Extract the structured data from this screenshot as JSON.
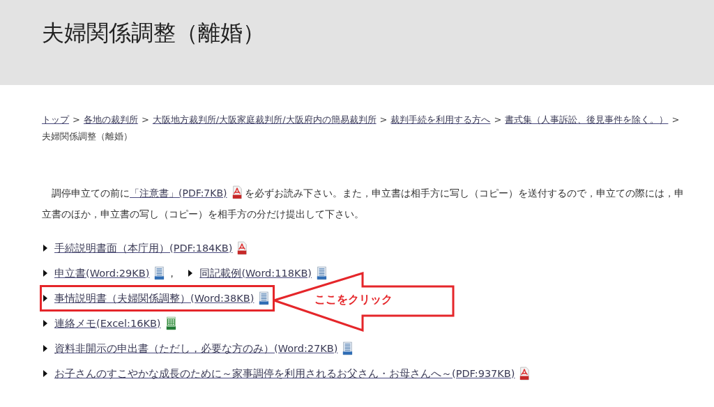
{
  "header": {
    "title": "夫婦関係調整（離婚）"
  },
  "breadcrumb": {
    "separator": ">",
    "items": [
      {
        "text": "トップ",
        "link": true
      },
      {
        "text": "各地の裁判所",
        "link": true
      },
      {
        "text": "大阪地方裁判所/大阪家庭裁判所/大阪府内の簡易裁判所",
        "link": true
      },
      {
        "text": "裁判手続を利用する方へ",
        "link": true
      },
      {
        "text": "書式集（人事訴訟、後見事件を除く。）",
        "link": true
      },
      {
        "text": "夫婦関係調整（離婚）",
        "link": false
      }
    ]
  },
  "notice": {
    "before": "調停申立ての前に",
    "link": "「注意書」(PDF:7KB)",
    "kind": "pdf",
    "after": "を必ずお読み下さい。また，申立書は相手方に写し（コピー）を送付するので，申立ての際には，申立書のほか，申立書の写し（コピー）を相手方の分だけ提出して下さい。"
  },
  "files": [
    {
      "highlighted": false,
      "links": [
        {
          "text": "手続説明書面（本庁用）(PDF:184KB)",
          "kind": "pdf"
        }
      ]
    },
    {
      "highlighted": false,
      "links": [
        {
          "text": "申立書(Word:29KB)",
          "kind": "doc",
          "separator": "，"
        },
        {
          "text": "同記載例(Word:118KB)",
          "kind": "doc"
        }
      ]
    },
    {
      "highlighted": true,
      "links": [
        {
          "text": "事情説明書（夫婦関係調整）(Word:38KB)",
          "kind": "doc"
        }
      ]
    },
    {
      "highlighted": false,
      "links": [
        {
          "text": "連絡メモ(Excel:16KB)",
          "kind": "xls"
        }
      ]
    },
    {
      "highlighted": false,
      "links": [
        {
          "text": "資料非開示の申出書（ただし，必要な方のみ）(Word:27KB)",
          "kind": "doc"
        }
      ]
    },
    {
      "highlighted": false,
      "links": [
        {
          "text": "お子さんのすこやかな成長のために～家事調停を利用されるお父さん・お母さんへ～(PDF:937KB)",
          "kind": "pdf"
        }
      ]
    }
  ],
  "callout": {
    "text": "ここをクリック"
  }
}
